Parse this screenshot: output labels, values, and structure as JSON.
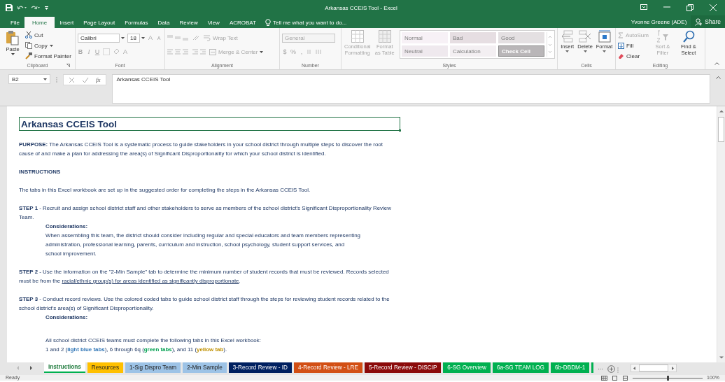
{
  "window": {
    "title": "Arkansas CCEIS Tool - Excel",
    "user": "Yvonne Greene (ADE)",
    "share": "Share"
  },
  "menu_tabs": [
    {
      "label": "File",
      "selected": false
    },
    {
      "label": "Home",
      "selected": true
    },
    {
      "label": "Insert",
      "selected": false
    },
    {
      "label": "Page Layout",
      "selected": false
    },
    {
      "label": "Formulas",
      "selected": false
    },
    {
      "label": "Data",
      "selected": false
    },
    {
      "label": "Review",
      "selected": false
    },
    {
      "label": "View",
      "selected": false
    },
    {
      "label": "ACROBAT",
      "selected": false
    }
  ],
  "tell_me": {
    "placeholder": "Tell me what you want to do..."
  },
  "ribbon": {
    "clipboard": {
      "label": "Clipboard",
      "paste": "Paste",
      "cut": "Cut",
      "copy": "Copy",
      "format_painter": "Format Painter"
    },
    "font": {
      "label": "Font",
      "name": "Calibri",
      "size": "18",
      "tools_disabled": true,
      "grow": "A",
      "shrink": "A",
      "bold": "B",
      "italic": "I",
      "underline": "U",
      "font_color": "A"
    },
    "alignment": {
      "label": "Alignment",
      "wrap_text": {
        "label": "Wrap Text",
        "disabled": true
      },
      "merge": {
        "label": "Merge & Center",
        "disabled": true
      }
    },
    "number": {
      "label": "Number",
      "disabled": true,
      "format": "General",
      "currency": "$",
      "percent": "%",
      "comma": ","
    },
    "styles": {
      "label": "Styles",
      "conditional": {
        "label": "Conditional Formatting",
        "disabled": true
      },
      "format_table": {
        "label": "Format as Table",
        "disabled": true
      },
      "cell_styles": [
        {
          "label": "Normal",
          "color": "#f7f1f6"
        },
        {
          "label": "Bad",
          "color": "#e6dee2"
        },
        {
          "label": "Good",
          "color": "#e4e0e2"
        },
        {
          "label": "Neutral",
          "color": "#efe9ee"
        },
        {
          "label": "Calculation",
          "color": "#f3eff2"
        },
        {
          "label": "Check Cell",
          "color": "#b9b6b8"
        }
      ]
    },
    "cells": {
      "label": "Cells",
      "buttons": [
        {
          "label": "Insert",
          "kind": "insert"
        },
        {
          "label": "Delete",
          "kind": "delete"
        },
        {
          "label": "Format",
          "kind": "format"
        }
      ]
    },
    "editing": {
      "label": "Editing",
      "autosum": {
        "label": "AutoSum",
        "disabled": true
      },
      "fill": {
        "label": "Fill",
        "disabled": false
      },
      "clear": {
        "label": "Clear",
        "disabled": false
      },
      "sort": {
        "label": "Sort & Filter",
        "disabled": true
      },
      "find": {
        "label": "Find & Select",
        "disabled": false
      }
    }
  },
  "formula_bar": {
    "name_box": "B2",
    "fx": "fx",
    "value": "Arkansas CCEIS Tool"
  },
  "sheet": {
    "title": "Arkansas CCEIS Tool",
    "blocks": [
      {
        "kind": "para",
        "text": "**PURPOSE:** The Arkansas CCEIS Tool is a systematic process to guide stakeholders in your school district through multiple steps to discover the root cause of and make a plan for addressing the area(s) of Significant Disproportionality for which your school district is identified."
      },
      {
        "kind": "heading",
        "text": "INSTRUCTIONS"
      },
      {
        "kind": "para",
        "text": "The tabs in this Excel workbook are set up in the suggested order for completing the steps in the Arkansas CCEIS Tool."
      },
      {
        "kind": "para",
        "text": "**STEP 1** - Recruit and assign school district staff and other stakeholders to serve as members of the school district's Significant Disproportionality Review Team."
      },
      {
        "kind": "sub_heading",
        "text": "Considerations:"
      },
      {
        "kind": "sub_para",
        "text": "When assembling this team, the district should consider including regular and special educators and team members representing administration, professional learning, parents, curriculum and instruction, school psychology, student support services, and school improvement."
      },
      {
        "kind": "para_underline",
        "text": "**STEP 2** - Use the information on the \"2-Min Sample\" tab to determine the minimum number of student records that must be reviewed. Records selected must be from the ",
        "underlined": "racial/ethnic group(s) for areas identified as significantly disproportionate",
        "end": "."
      },
      {
        "kind": "para",
        "text": "**STEP 3** - Conduct record reviews. Use the colored coded tabs to guide school district staff through the steps for reviewing student records related to the school district's area(s) of Significant Disproportionality."
      },
      {
        "kind": "sub_heading",
        "text": "Considerations:"
      },
      {
        "kind": "note",
        "text": "All school district CCEIS teams must complete the following tabs in this Excel workbook:"
      },
      {
        "kind": "colored",
        "segments": [
          {
            "text": "1 and 2 ("
          },
          {
            "text": "light blue tabs",
            "color": "#2e75b6"
          },
          {
            "text": "), 6 through 6q ("
          },
          {
            "text": "green tabs",
            "color": "#00a050"
          },
          {
            "text": "), and 11 ("
          },
          {
            "text": "yellow tab",
            "color": "#bf9000"
          },
          {
            "text": ")."
          }
        ]
      }
    ]
  },
  "sheet_tabs": [
    {
      "label": "Instructions",
      "color": "#00b050",
      "selected": true
    },
    {
      "label": "Resources",
      "color": "#ffc000",
      "selected": false
    },
    {
      "label": "1-Sig Dispro Team",
      "color": "#9dc3e6",
      "selected": false
    },
    {
      "label": "2-Min Sample",
      "color": "#9dc3e6",
      "selected": false
    },
    {
      "label": "3-Record Review - ID",
      "color": "#002060",
      "selected": false
    },
    {
      "label": "4-Record Review - LRE",
      "color": "#d24f14",
      "selected": false
    },
    {
      "label": "5-Record Review - DISCIP",
      "color": "#8b0a0a",
      "selected": false
    },
    {
      "label": "6-SG Overview",
      "color": "#00b050",
      "selected": false
    },
    {
      "label": "6a-SG TEAM LOG",
      "color": "#00b050",
      "selected": false
    },
    {
      "label": "6b-DBDM-1",
      "color": "#00b050",
      "selected": false
    }
  ],
  "more_tabs": "...",
  "status_bar": {
    "ready": "Ready",
    "zoom": "100%",
    "zoom_slider": {
      "level": 0.5
    }
  }
}
